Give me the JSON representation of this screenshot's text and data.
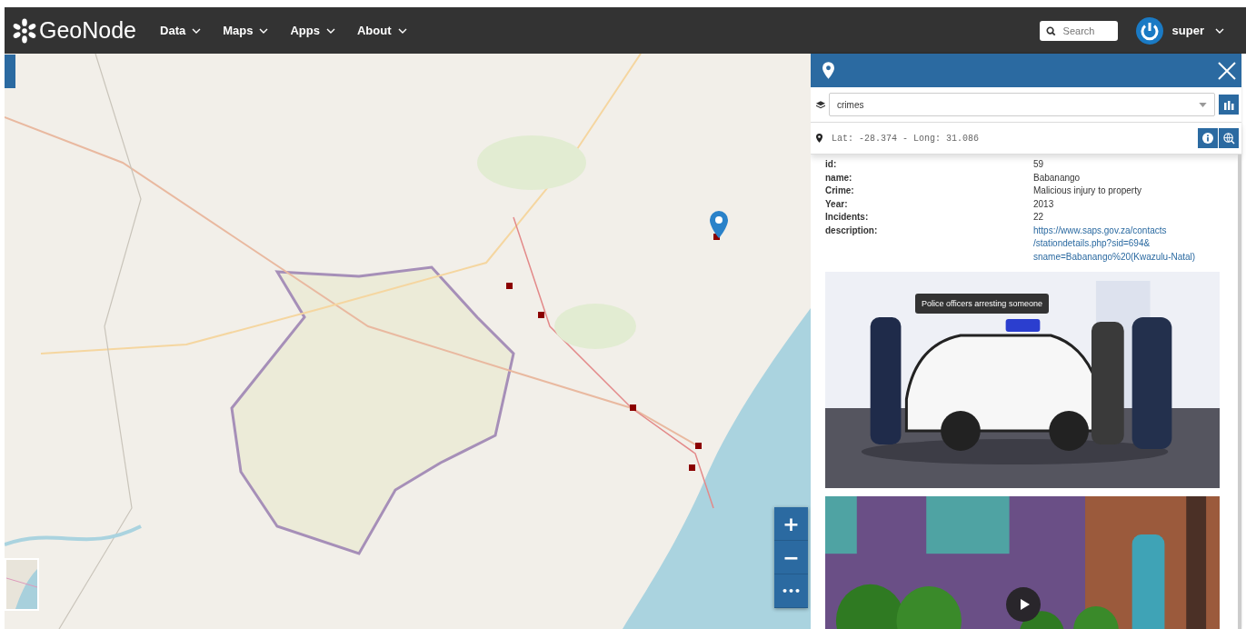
{
  "brand": {
    "name": "GeoNode"
  },
  "nav": [
    {
      "label": "Data"
    },
    {
      "label": "Maps"
    },
    {
      "label": "Apps"
    },
    {
      "label": "About"
    }
  ],
  "search": {
    "placeholder": "Search"
  },
  "user": {
    "name": "super"
  },
  "map": {
    "zoom_controls": [
      "+",
      "−",
      "•••"
    ]
  },
  "panel": {
    "layer": "crimes",
    "coordinates": "Lat: -28.374 - Long: 31.086",
    "attributes": [
      {
        "key": "id:",
        "value": "59",
        "kind": "text"
      },
      {
        "key": "name:",
        "value": "Babanango",
        "kind": "text"
      },
      {
        "key": "Crime:",
        "value": "Malicious injury to property",
        "kind": "text"
      },
      {
        "key": "Year:",
        "value": "2013",
        "kind": "text"
      },
      {
        "key": "Incidents:",
        "value": "22",
        "kind": "text"
      },
      {
        "key": "description:",
        "value": "https://www.saps.gov.za/contacts /stationdetails.php?sid=694& sname=Babanango%20(Kwazulu-Natal)",
        "kind": "link"
      }
    ],
    "media": [
      {
        "tooltip": "Police officers arresting someone"
      },
      {
        "kind": "video"
      }
    ]
  }
}
